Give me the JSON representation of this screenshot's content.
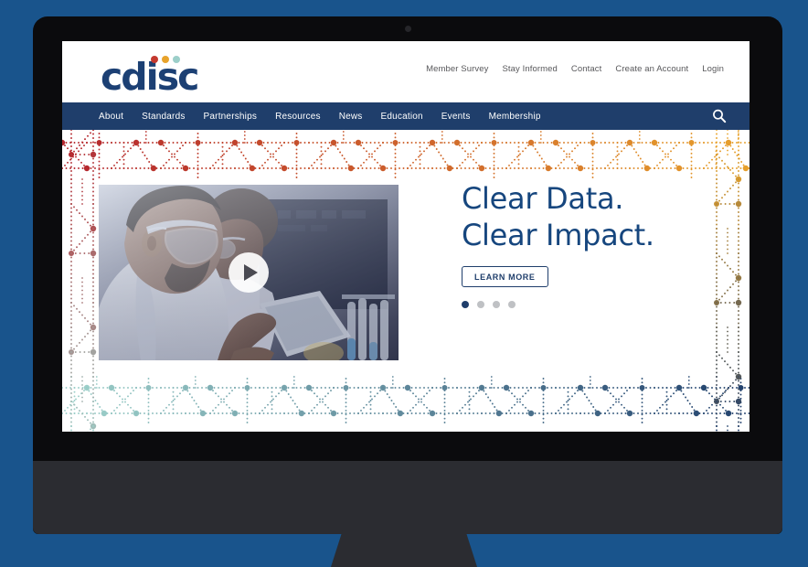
{
  "scene": {
    "background_color": "#19548c",
    "bezel_color": "#0b0b0d",
    "chin_color": "#2b2c31"
  },
  "brand": {
    "logo_text": "cdisc",
    "logo_color": "#1c4074",
    "dot_colors": [
      "#c4392f",
      "#e8a32b",
      "#9ccfc9"
    ]
  },
  "utility_nav": {
    "items": [
      {
        "label": "Member Survey"
      },
      {
        "label": "Stay Informed"
      },
      {
        "label": "Contact"
      },
      {
        "label": "Create an Account"
      },
      {
        "label": "Login"
      }
    ]
  },
  "main_nav": {
    "background_color": "#1f3e6b",
    "items": [
      {
        "label": "About"
      },
      {
        "label": "Standards"
      },
      {
        "label": "Partnerships"
      },
      {
        "label": "Resources"
      },
      {
        "label": "News"
      },
      {
        "label": "Education"
      },
      {
        "label": "Events"
      },
      {
        "label": "Membership"
      }
    ],
    "search_icon": "search-icon"
  },
  "hero": {
    "headline_line1": "Clear Data.",
    "headline_line2": "Clear Impact.",
    "headline_color": "#16467e",
    "cta_label": "LEARN MORE",
    "video": {
      "play_icon": "play-icon",
      "alt": "Two scientists in lab coats and safety glasses reviewing data on a tablet in a laboratory"
    },
    "carousel": {
      "total": 4,
      "active_index": 0,
      "active_color": "#1f3e6b",
      "inactive_color": "#bfc1c4"
    },
    "decor": {
      "name": "dna-network-pattern",
      "top_colors": [
        "#b5272d",
        "#e8a32b"
      ],
      "bottom_colors": [
        "#9ccfc9",
        "#1f3e6b"
      ],
      "left_colors": [
        "#b5272d",
        "#9ccfc9"
      ],
      "right_colors": [
        "#e8a32b",
        "#1f3e6b"
      ]
    }
  }
}
